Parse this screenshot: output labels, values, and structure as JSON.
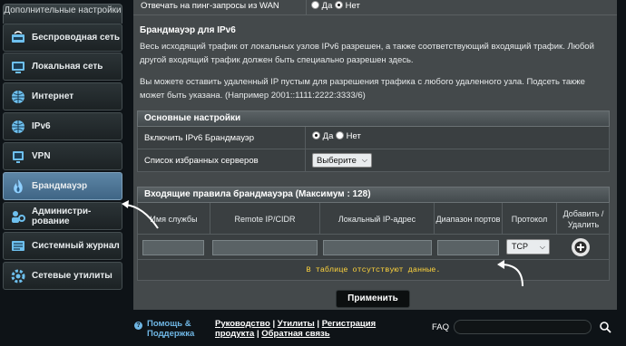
{
  "sidebar": {
    "header": "Дополнительные настройки",
    "items": [
      {
        "label": "Беспроводная сеть",
        "icon": "wireless-icon"
      },
      {
        "label": "Локальная сеть",
        "icon": "lan-icon"
      },
      {
        "label": "Интернет",
        "icon": "globe-icon"
      },
      {
        "label": "IPv6",
        "icon": "ipv6-globe-icon"
      },
      {
        "label": "VPN",
        "icon": "vpn-icon"
      },
      {
        "label": "Брандмауэр",
        "icon": "firewall-icon",
        "active": true
      },
      {
        "label": "Администри-\nрование",
        "icon": "admin-icon"
      },
      {
        "label": "Системный журнал",
        "icon": "syslog-icon"
      },
      {
        "label": "Сетевые утилиты",
        "icon": "network-tools-icon"
      }
    ]
  },
  "ping": {
    "label": "Отвечать на пинг-запросы из WAN",
    "yes": "Да",
    "no": "Нет",
    "selected": "no"
  },
  "firewall": {
    "title": "Брандмауэр для IPv6",
    "desc1": "Весь исходящий трафик от локальных узлов IPv6 разрешен, а также соответствующий входящий трафик. Любой другой входящий трафик должен быть специально разрешен здесь.",
    "desc2": "Вы можете оставить удаленный IP пустым для разрешения трафика с любого удаленного узла. Подсеть также может быть указана. (Например 2001::1111:2222:3333/6)"
  },
  "basic": {
    "header": "Основные настройки",
    "enable_label": "Включить IPv6 Брандмауэр",
    "yes": "Да",
    "no": "Нет",
    "enable_selected": "yes",
    "servers_label": "Список избранных серверов",
    "servers_select": "Выберите"
  },
  "rules": {
    "header": "Входящие правила брандмауэра (Максимум : 128)",
    "columns": [
      "Имя службы",
      "Remote IP/CIDR",
      "Локальный IP-адрес",
      "Диапазон портов",
      "Протокол",
      "Добавить / Удалить"
    ],
    "protocol_value": "TCP",
    "empty_text": "В таблице отсутствуют данные."
  },
  "apply_label": "Применить",
  "footer": {
    "help_line1": "Помощь &",
    "help_line2": "Поддержка",
    "link_manual": "Руководство",
    "link_utils": "Утилиты",
    "link_reg1": "Регистрация",
    "link_reg2": "продукта",
    "link_feedback": "Обратная связь",
    "faq_label": "FAQ"
  }
}
